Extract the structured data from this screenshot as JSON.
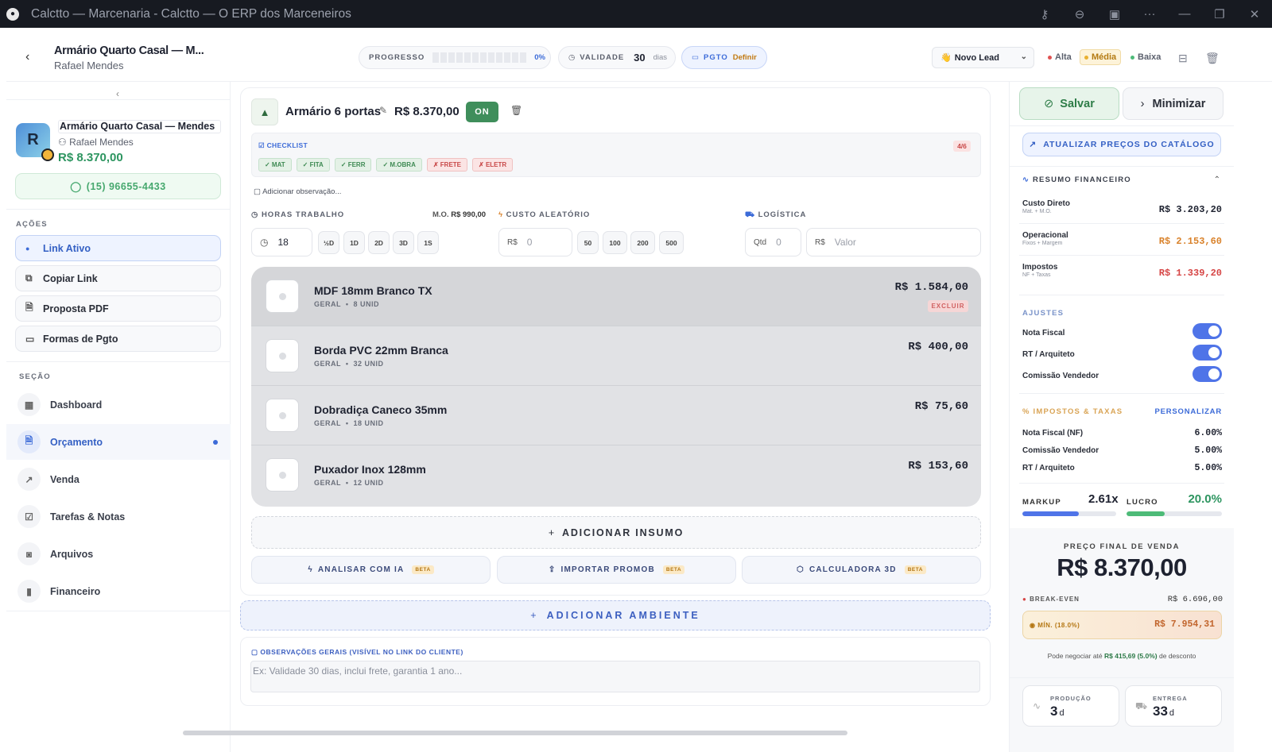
{
  "window": {
    "title": "Calctto — Marcenaria - Calctto — O ERP dos Marceneiros"
  },
  "header": {
    "project_title": "Armário Quarto Casal — M...",
    "client": "Rafael Mendes",
    "progress": {
      "label": "PROGRESSO",
      "value_text": "0%",
      "value": 0
    },
    "validity": {
      "label": "VALIDADE",
      "value": "30",
      "unit": "dias"
    },
    "payment": {
      "label": "PGTO",
      "value": "Definir"
    },
    "lead_status": "Novo Lead",
    "priorities": [
      {
        "label": "Alta",
        "color": "#e05252"
      },
      {
        "label": "Média",
        "color": "#e9b030",
        "selected": true
      },
      {
        "label": "Baixa",
        "color": "#4dbb78"
      }
    ]
  },
  "sidebar": {
    "client_card": {
      "initial": "R",
      "project_name": "Armário Quarto Casal — Mendes",
      "client": "Rafael Mendes",
      "price": "R$ 8.370,00",
      "phone": "(15) 96655-4433"
    },
    "actions_label": "AÇÕES",
    "actions": [
      {
        "label": "Link Ativo",
        "active": true
      },
      {
        "label": "Copiar Link"
      },
      {
        "label": "Proposta PDF"
      },
      {
        "label": "Formas de Pgto"
      }
    ],
    "section_label": "SEÇÃO",
    "nav": [
      {
        "label": "Dashboard"
      },
      {
        "label": "Orçamento",
        "active": true
      },
      {
        "label": "Venda"
      },
      {
        "label": "Tarefas & Notas"
      },
      {
        "label": "Arquivos"
      },
      {
        "label": "Financeiro"
      }
    ]
  },
  "environment": {
    "name": "Armário 6 portas",
    "price": "R$ 8.370,00",
    "toggle": "ON",
    "checklist": {
      "title": "CHECKLIST",
      "count": "4/6",
      "items": [
        {
          "label": "✓ MAT",
          "ok": true
        },
        {
          "label": "✓ FITA",
          "ok": true
        },
        {
          "label": "✓ FERR",
          "ok": true
        },
        {
          "label": "✓ M.OBRA",
          "ok": true
        },
        {
          "label": "✗ FRETE",
          "ok": false
        },
        {
          "label": "✗ ELETR",
          "ok": false
        }
      ]
    },
    "add_observation": "Adicionar observação...",
    "hours": {
      "label": "HORAS TRABALHO",
      "mo_label": "M.O.",
      "mo_value": "R$ 990,00",
      "value": "18",
      "presets": [
        "½D",
        "1D",
        "2D",
        "3D",
        "1S"
      ]
    },
    "random_cost": {
      "label": "CUSTO ALEATÓRIO",
      "currency": "R$",
      "placeholder": "0",
      "presets": [
        "50",
        "100",
        "200",
        "500"
      ]
    },
    "logistics": {
      "label": "LOGÍSTICA",
      "qty_label": "Qtd",
      "qty_placeholder": "0",
      "currency": "R$",
      "value_placeholder": "Valor"
    },
    "items": [
      {
        "name": "MDF 18mm Branco TX",
        "category": "GERAL",
        "qty": "8 UNID",
        "price": "R$ 1.584,00",
        "delete_label": "EXCLUIR"
      },
      {
        "name": "Borda PVC 22mm Branca",
        "category": "GERAL",
        "qty": "32 UNID",
        "price": "R$ 400,00"
      },
      {
        "name": "Dobradiça Caneco 35mm",
        "category": "GERAL",
        "qty": "18 UNID",
        "price": "R$ 75,60"
      },
      {
        "name": "Puxador Inox 128mm",
        "category": "GERAL",
        "qty": "12 UNID",
        "price": "R$ 153,60"
      }
    ],
    "add_input": "ADICIONAR INSUMO",
    "tools": [
      {
        "label": "ANALISAR COM IA",
        "badge": "BETA"
      },
      {
        "label": "IMPORTAR PROMOB",
        "badge": "BETA"
      },
      {
        "label": "CALCULADORA 3D",
        "badge": "BETA"
      }
    ]
  },
  "add_environment": "ADICIONAR AMBIENTE",
  "general_notes": {
    "label": "OBSERVAÇÕES GERAIS (VISÍVEL NO LINK DO CLIENTE)",
    "placeholder": "Ex: Validade 30 dias, inclui frete, garantia 1 ano..."
  },
  "right": {
    "save": "Salvar",
    "minimize": "Minimizar",
    "update_prices": "ATUALIZAR PREÇOS DO CATÁLOGO",
    "summary_title": "RESUMO FINANCEIRO",
    "summary": [
      {
        "label": "Custo Direto",
        "sub": "Mat. + M.O.",
        "value": "R$ 3.203,20",
        "color": "#1e2230"
      },
      {
        "label": "Operacional",
        "sub": "Fixos + Margem",
        "value": "R$ 2.153,60",
        "color": "#d9822b"
      },
      {
        "label": "Impostos",
        "sub": "NF + Taxas",
        "value": "R$ 1.339,20",
        "color": "#d64545"
      }
    ],
    "adjust_title": "AJUSTES",
    "adjustments": [
      {
        "label": "Nota Fiscal",
        "on": true
      },
      {
        "label": "RT / Arquiteto",
        "on": true
      },
      {
        "label": "Comissão Vendedor",
        "on": true
      }
    ],
    "taxes_title": "IMPOSTOS & TAXAS",
    "taxes_action": "PERSONALIZAR",
    "taxes": [
      {
        "label": "Nota Fiscal (NF)",
        "value": "6.00%"
      },
      {
        "label": "Comissão Vendedor",
        "value": "5.00%"
      },
      {
        "label": "RT / Arquiteto",
        "value": "5.00%"
      }
    ],
    "markup_label": "MARKUP",
    "markup_value": "2.61x",
    "markup_fill": 0.6,
    "profit_label": "LUCRO",
    "profit_value": "20.0%",
    "profit_fill": 0.4,
    "final_label": "PREÇO FINAL DE VENDA",
    "final_price": "R$ 8.370,00",
    "breakeven_label": "BREAK-EVEN",
    "breakeven_value": "R$ 6.696,00",
    "min_label": "MÍN. (18.0%)",
    "min_value": "R$ 7.954,31",
    "negotiate_prefix": "Pode negociar até",
    "negotiate_value": "R$ 415,69 (5.0%)",
    "negotiate_suffix": "de desconto",
    "production_label": "PRODUÇÃO",
    "production_value": "3",
    "delivery_label": "ENTREGA",
    "delivery_value": "33",
    "days_unit": "d"
  },
  "colors": {
    "accent": "#3c6bd8",
    "success": "#2d9560",
    "danger": "#d64545",
    "warning": "#d9822b"
  }
}
